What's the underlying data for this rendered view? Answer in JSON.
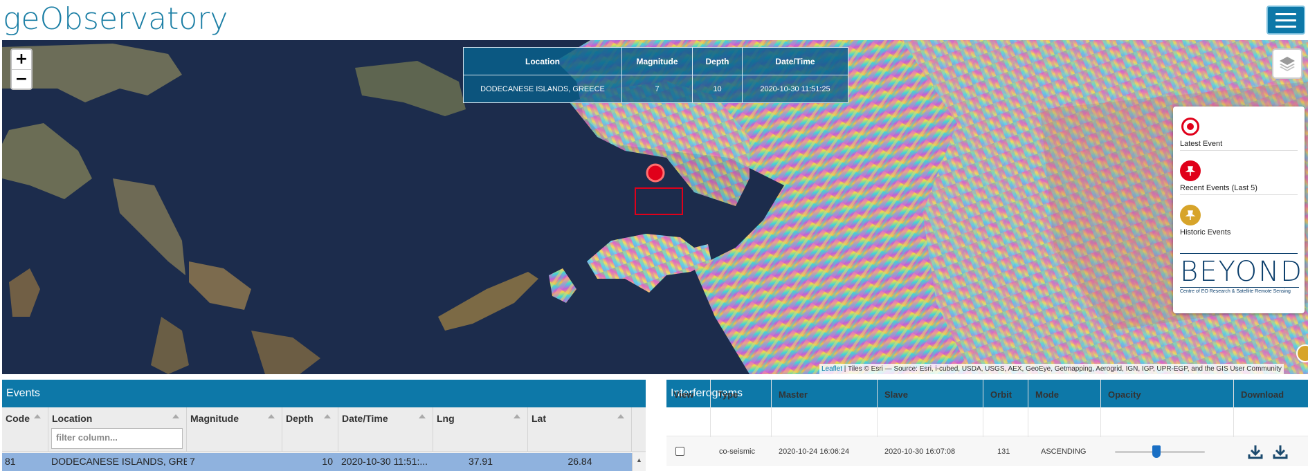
{
  "header": {
    "logo": "geObservatory",
    "menu_icon": "hamburger-icon"
  },
  "map": {
    "zoom_in": "+",
    "zoom_out": "−",
    "layers_icon": "layers-icon",
    "info_table": {
      "headers": [
        "Location",
        "Magnitude",
        "Depth",
        "Date/Time"
      ],
      "row": [
        "DODECANESE ISLANDS, GREECE",
        "7",
        "10",
        "2020-10-30 11:51:25"
      ]
    },
    "legend": {
      "items": [
        {
          "label": "Latest Event",
          "icon": "target-icon",
          "color": "#e0001a"
        },
        {
          "label": "Recent Events (Last 5)",
          "icon": "pin-icon",
          "color": "#e0001a"
        },
        {
          "label": "Historic Events",
          "icon": "pin-icon",
          "color": "#d7a42a"
        }
      ],
      "logo_text": "BEYOND",
      "logo_sub": "Centre of EO Research & Satellite Remote Sensing"
    },
    "attribution": {
      "leaflet": "Leaflet",
      "text": " | Tiles © Esri — Source: Esri, i-cubed, USDA, USGS, AEX, GeoEye, Getmapping, Aerogrid, IGN, IGP, UPR-EGP, and the GIS User Community"
    }
  },
  "events": {
    "title": "Events",
    "columns": [
      "Code",
      "Location",
      "Magnitude",
      "Depth",
      "Date/Time",
      "Lng",
      "Lat"
    ],
    "filter_placeholder": "filter column...",
    "rows": [
      {
        "code": "81",
        "location": "DODECANESE ISLANDS, GRE...",
        "magnitude": "7",
        "depth": "10",
        "datetime": "2020-10-30 11:51:...",
        "lng": "37.91",
        "lat": "26.84"
      }
    ]
  },
  "interferograms": {
    "title": "Interferograms",
    "columns": [
      "View",
      "Type",
      "Master",
      "Slave",
      "Orbit",
      "Mode",
      "Opacity",
      "Download"
    ],
    "rows": [
      {
        "type": "co-seismic",
        "master": "2020-10-24 16:06:24",
        "slave": "2020-10-30 16:07:08",
        "orbit": "131",
        "mode": "ASCENDING"
      }
    ]
  }
}
